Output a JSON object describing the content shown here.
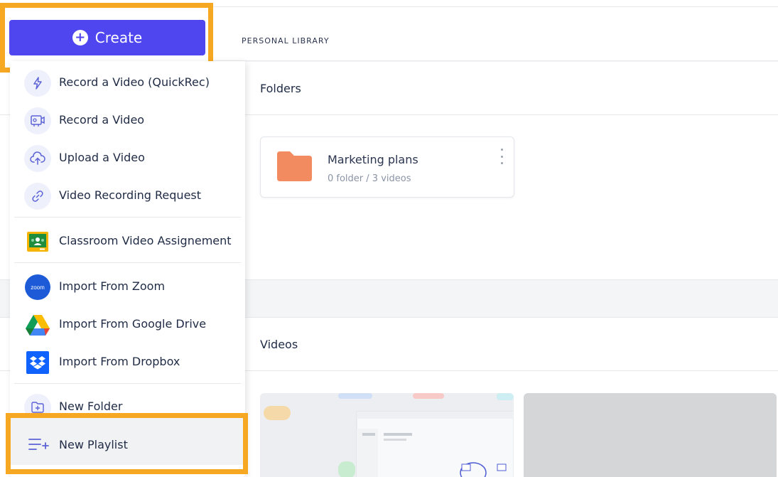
{
  "header": {
    "breadcrumb": "PERSONAL LIBRARY"
  },
  "create_button": {
    "label": "Create"
  },
  "menu": {
    "items": [
      {
        "label": "Record a Video (QuickRec)",
        "icon": "lightning-icon"
      },
      {
        "label": "Record a Video",
        "icon": "screen-record-icon"
      },
      {
        "label": "Upload a Video",
        "icon": "cloud-upload-icon"
      },
      {
        "label": "Video Recording Request",
        "icon": "link-icon"
      },
      {
        "label": "Classroom Video Assignement",
        "icon": "google-classroom-icon"
      },
      {
        "label": "Import From Zoom",
        "icon": "zoom-icon"
      },
      {
        "label": "Import From Google Drive",
        "icon": "google-drive-icon"
      },
      {
        "label": "Import From Dropbox",
        "icon": "dropbox-icon"
      },
      {
        "label": "New Folder",
        "icon": "new-folder-icon"
      },
      {
        "label": "New Playlist",
        "icon": "playlist-add-icon"
      }
    ],
    "zoom_logo_text": "zoom"
  },
  "folders": {
    "title": "Folders",
    "items": [
      {
        "name": "Marketing plans",
        "meta": "0 folder / 3 videos"
      }
    ]
  },
  "videos": {
    "title": "Videos"
  },
  "colors": {
    "accent": "#5046f0",
    "highlight": "#f7a823",
    "folder": "#f28b60"
  }
}
